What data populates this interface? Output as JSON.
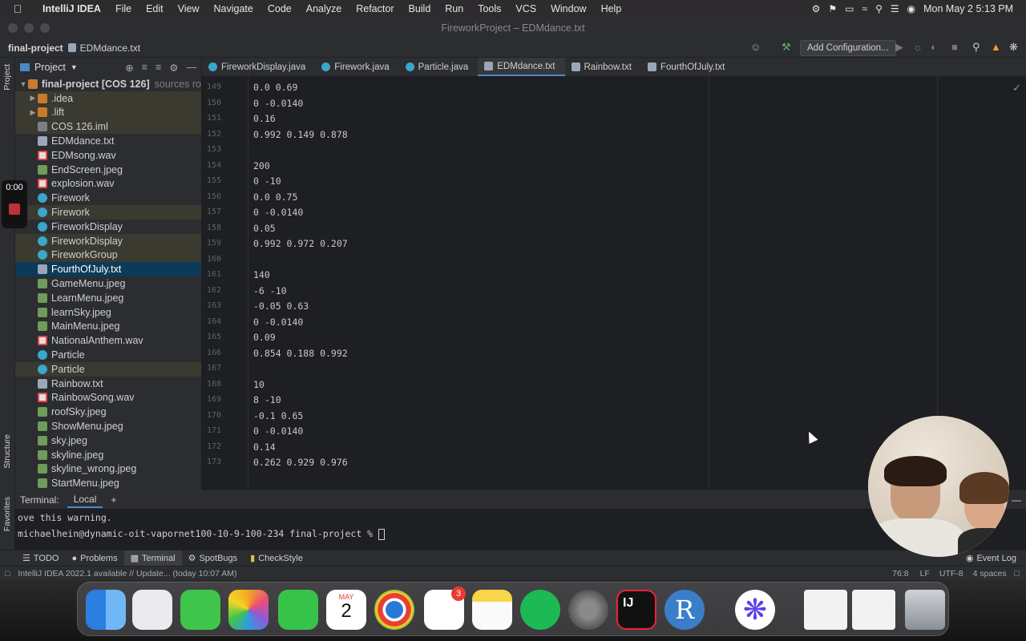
{
  "menubar": {
    "app": "IntelliJ IDEA",
    "items": [
      "File",
      "Edit",
      "View",
      "Navigate",
      "Code",
      "Analyze",
      "Refactor",
      "Build",
      "Run",
      "Tools",
      "VCS",
      "Window",
      "Help"
    ],
    "clock": "Mon May 2  5:13 PM"
  },
  "window": {
    "title": "FireworkProject – EDMdance.txt"
  },
  "navbar": {
    "project": "final-project",
    "file": "EDMdance.txt",
    "add_configuration": "Add Configuration..."
  },
  "leftstrip": {
    "project_label": "Project",
    "structure_label": "Structure",
    "favorites_label": "Favorites"
  },
  "project_panel": {
    "title": "Project",
    "root": "final-project [COS 126]",
    "root_hint": "sources ro",
    "items": [
      {
        "name": ".idea",
        "kind": "folder",
        "state": "mod",
        "arrow": "▶"
      },
      {
        "name": ".lift",
        "kind": "folder",
        "state": "mod",
        "arrow": "▶"
      },
      {
        "name": "COS 126.iml",
        "kind": "iml",
        "state": "mod",
        "arrow": ""
      },
      {
        "name": "EDMdance.txt",
        "kind": "txt",
        "state": "",
        "arrow": ""
      },
      {
        "name": "EDMsong.wav",
        "kind": "wav",
        "state": "",
        "arrow": ""
      },
      {
        "name": "EndScreen.jpeg",
        "kind": "img",
        "state": "",
        "arrow": ""
      },
      {
        "name": "explosion.wav",
        "kind": "wav",
        "state": "",
        "arrow": ""
      },
      {
        "name": "Firework",
        "kind": "cls",
        "state": "",
        "arrow": ""
      },
      {
        "name": "Firework",
        "kind": "cls",
        "state": "mod",
        "arrow": ""
      },
      {
        "name": "FireworkDisplay",
        "kind": "cls",
        "state": "",
        "arrow": ""
      },
      {
        "name": "FireworkDisplay",
        "kind": "cls",
        "state": "mod",
        "arrow": ""
      },
      {
        "name": "FireworkGroup",
        "kind": "cls",
        "state": "mod",
        "arrow": ""
      },
      {
        "name": "FourthOfJuly.txt",
        "kind": "txt",
        "state": "sel",
        "arrow": ""
      },
      {
        "name": "GameMenu.jpeg",
        "kind": "img",
        "state": "",
        "arrow": ""
      },
      {
        "name": "LearnMenu.jpeg",
        "kind": "img",
        "state": "",
        "arrow": ""
      },
      {
        "name": "learnSky.jpeg",
        "kind": "img",
        "state": "",
        "arrow": ""
      },
      {
        "name": "MainMenu.jpeg",
        "kind": "img",
        "state": "",
        "arrow": ""
      },
      {
        "name": "NationalAnthem.wav",
        "kind": "wav",
        "state": "",
        "arrow": ""
      },
      {
        "name": "Particle",
        "kind": "cls",
        "state": "",
        "arrow": ""
      },
      {
        "name": "Particle",
        "kind": "cls",
        "state": "mod",
        "arrow": ""
      },
      {
        "name": "Rainbow.txt",
        "kind": "txt",
        "state": "",
        "arrow": ""
      },
      {
        "name": "RainbowSong.wav",
        "kind": "wav",
        "state": "",
        "arrow": ""
      },
      {
        "name": "roofSky.jpeg",
        "kind": "img",
        "state": "",
        "arrow": ""
      },
      {
        "name": "ShowMenu.jpeg",
        "kind": "img",
        "state": "",
        "arrow": ""
      },
      {
        "name": "sky.jpeg",
        "kind": "img",
        "state": "",
        "arrow": ""
      },
      {
        "name": "skyline.jpeg",
        "kind": "img",
        "state": "",
        "arrow": ""
      },
      {
        "name": "skyline_wrong.jpeg",
        "kind": "img",
        "state": "",
        "arrow": ""
      },
      {
        "name": "StartMenu.jpeg",
        "kind": "img",
        "state": "",
        "arrow": ""
      }
    ]
  },
  "tabs": [
    {
      "label": "FireworkDisplay.java",
      "kind": "cls",
      "active": false
    },
    {
      "label": "Firework.java",
      "kind": "cls",
      "active": false
    },
    {
      "label": "Particle.java",
      "kind": "cls",
      "active": false
    },
    {
      "label": "EDMdance.txt",
      "kind": "txt",
      "active": true
    },
    {
      "label": "Rainbow.txt",
      "kind": "txt",
      "active": false
    },
    {
      "label": "FourthOfJuly.txt",
      "kind": "txt",
      "active": false
    }
  ],
  "editor": {
    "lines": [
      {
        "n": "149",
        "t": "0.0 0.69"
      },
      {
        "n": "150",
        "t": "0 -0.0140"
      },
      {
        "n": "151",
        "t": "0.16"
      },
      {
        "n": "152",
        "t": "0.992 0.149 0.878"
      },
      {
        "n": "153",
        "t": ""
      },
      {
        "n": "154",
        "t": "200"
      },
      {
        "n": "155",
        "t": "0 -10"
      },
      {
        "n": "156",
        "t": "0.0 0.75"
      },
      {
        "n": "157",
        "t": "0 -0.0140"
      },
      {
        "n": "158",
        "t": "0.05"
      },
      {
        "n": "159",
        "t": "0.992 0.972 0.207"
      },
      {
        "n": "160",
        "t": ""
      },
      {
        "n": "161",
        "t": "140"
      },
      {
        "n": "162",
        "t": "-6 -10"
      },
      {
        "n": "163",
        "t": "-0.05 0.63"
      },
      {
        "n": "164",
        "t": "0 -0.0140"
      },
      {
        "n": "165",
        "t": "0.09"
      },
      {
        "n": "166",
        "t": "0.854 0.188 0.992"
      },
      {
        "n": "167",
        "t": ""
      },
      {
        "n": "168",
        "t": "10"
      },
      {
        "n": "169",
        "t": "8 -10"
      },
      {
        "n": "170",
        "t": "-0.1 0.65"
      },
      {
        "n": "171",
        "t": "0 -0.0140"
      },
      {
        "n": "172",
        "t": "0.14"
      },
      {
        "n": "173",
        "t": "0.262 0.929 0.976"
      }
    ]
  },
  "terminal": {
    "title": "Terminal:",
    "tab": "Local",
    "add": "+",
    "line1": "ove this warning.",
    "prompt": "michaelhein@dynamic-oit-vapornet100-10-9-100-234 final-project % "
  },
  "bottom_tools": {
    "todo": "TODO",
    "problems": "Problems",
    "terminal": "Terminal",
    "spotbugs": "SpotBugs",
    "checkstyle": "CheckStyle",
    "event_log": "Event Log"
  },
  "status": {
    "message": "IntelliJ IDEA 2022.1 available // Update... (today 10:07 AM)",
    "position": "76:8",
    "line_sep": "LF",
    "encoding": "UTF-8",
    "indent": "4 spaces"
  },
  "recording": {
    "time": "0:00"
  },
  "dock": {
    "calendar_month": "MAY",
    "calendar_day": "2",
    "reminders_badge": "3",
    "rstudio_letter": "R",
    "intellij_letters": "IJ"
  },
  "colors": {
    "accent": "#4a88c7",
    "selection": "#0d3a58",
    "modified_row": "#3b3a30"
  }
}
